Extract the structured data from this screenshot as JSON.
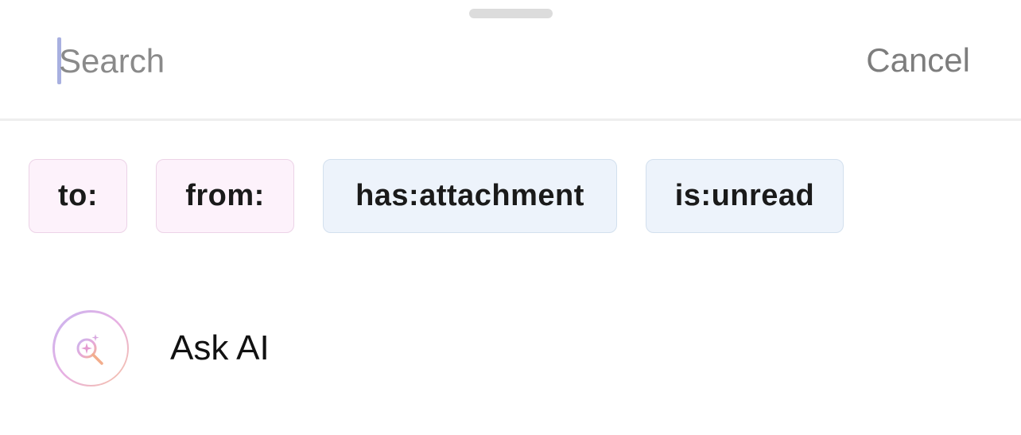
{
  "search": {
    "placeholder": "Search",
    "value": "",
    "cancel_label": "Cancel"
  },
  "filters": [
    {
      "label": "to:",
      "color": "#fdf2fb"
    },
    {
      "label": "from:",
      "color": "#fdf2fb"
    },
    {
      "label": "has:attachment",
      "color": "#edf3fb"
    },
    {
      "label": "is:unread",
      "color": "#edf3fb"
    }
  ],
  "ask_ai": {
    "label": "Ask AI",
    "icon": "ai-search-sparkle-icon"
  },
  "colors": {
    "caret": "#a8b0e0",
    "cancel_text": "#7d7d7d",
    "chip_pink_bg": "#fdf2fb",
    "chip_blue_bg": "#edf3fb"
  }
}
